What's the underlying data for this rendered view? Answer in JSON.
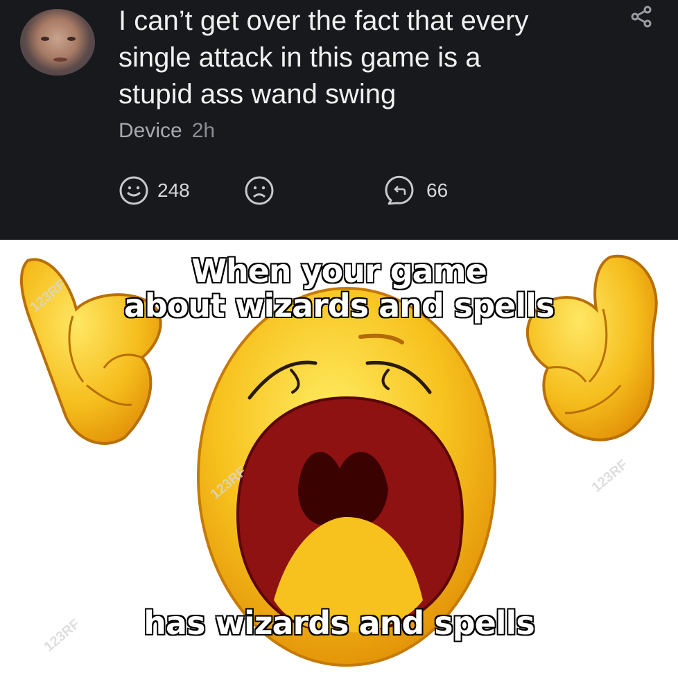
{
  "post": {
    "text": "I can’t get over the fact that every\nsingle attack in this game is a\nstupid ass wand swing",
    "device": "Device",
    "time": "2h",
    "likes": "248",
    "replies": "66"
  },
  "meme": {
    "top_caption": "When your game\nabout wizards and spells",
    "bottom_caption": "has wizards and spells",
    "watermark": "123RF"
  },
  "icons": [
    "share-icon",
    "smile-icon",
    "frown-icon",
    "reply-icon"
  ],
  "colors": {
    "post_bg": "#18191d",
    "emoji_yellow": "#f7c21e",
    "mouth": "#8e1212"
  }
}
